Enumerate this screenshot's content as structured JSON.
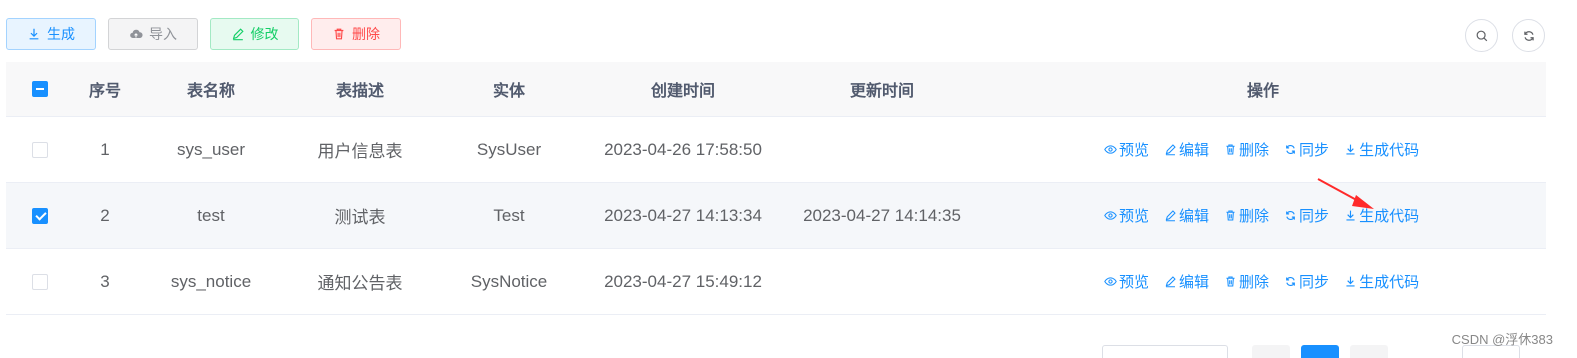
{
  "toolbar": {
    "generate_label": "生成",
    "import_label": "导入",
    "edit_label": "修改",
    "delete_label": "删除"
  },
  "table": {
    "headers": {
      "index": "序号",
      "table_name": "表名称",
      "table_desc": "表描述",
      "entity": "实体",
      "created": "创建时间",
      "updated": "更新时间",
      "actions": "操作"
    },
    "rows": [
      {
        "checked": false,
        "index": "1",
        "table_name": "sys_user",
        "table_desc": "用户信息表",
        "entity": "SysUser",
        "created": "2023-04-26 17:58:50",
        "updated": ""
      },
      {
        "checked": true,
        "index": "2",
        "table_name": "test",
        "table_desc": "测试表",
        "entity": "Test",
        "created": "2023-04-27 14:13:34",
        "updated": "2023-04-27 14:14:35"
      },
      {
        "checked": false,
        "index": "3",
        "table_name": "sys_notice",
        "table_desc": "通知公告表",
        "entity": "SysNotice",
        "created": "2023-04-27 15:49:12",
        "updated": ""
      }
    ],
    "actions": {
      "preview": "预览",
      "edit": "编辑",
      "delete": "删除",
      "sync": "同步",
      "generate_code": "生成代码"
    }
  },
  "watermark": "CSDN @浮休383",
  "colors": {
    "primary": "#1890ff",
    "success": "#13ce66",
    "danger": "#ff4949",
    "arrow": "#ff2a2a"
  }
}
